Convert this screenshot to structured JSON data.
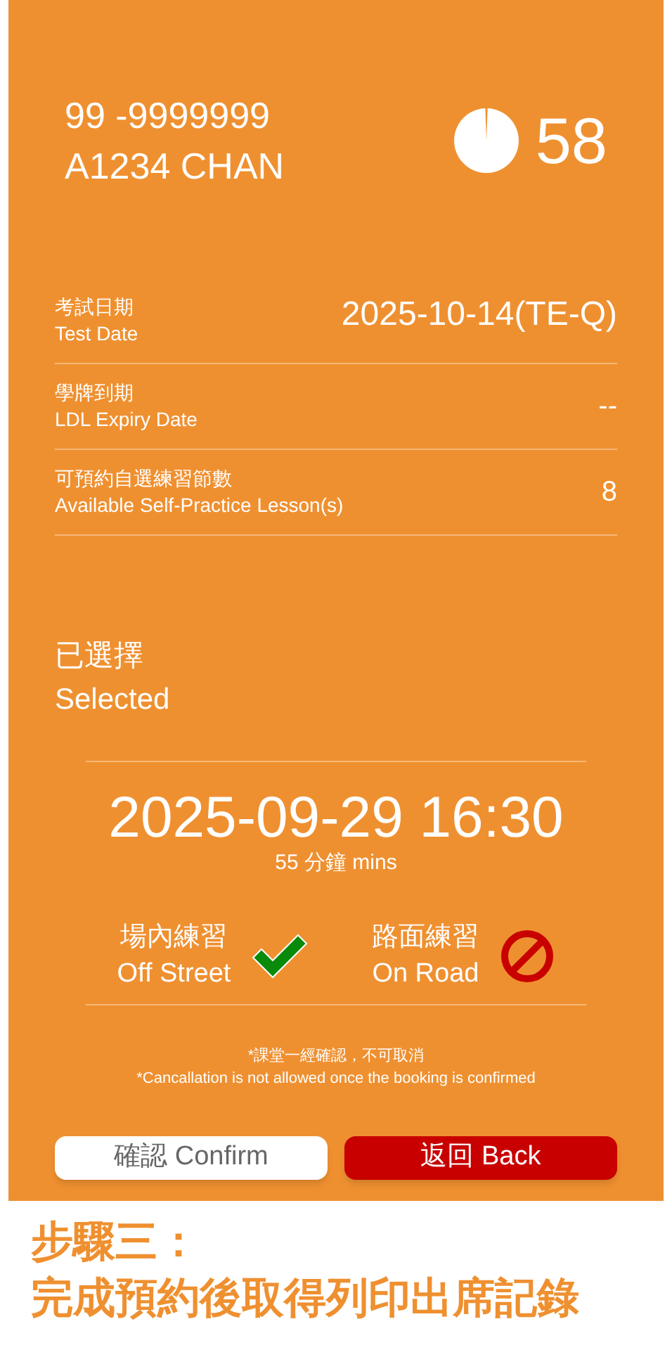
{
  "profile": {
    "phone": "99 -9999999",
    "name": "A1234 CHAN",
    "count": "58"
  },
  "info_rows": [
    {
      "label_zh": "考試日期",
      "label_en": "Test Date",
      "value": "2025-10-14(TE-Q)",
      "kind": "large"
    },
    {
      "label_zh": "學牌到期",
      "label_en": "LDL Expiry Date",
      "value": "--",
      "kind": "normal"
    },
    {
      "label_zh": "可預約自選練習節數",
      "label_en": "Available Self-Practice Lesson(s)",
      "value": "8",
      "kind": "normal"
    }
  ],
  "selected": {
    "heading_zh": "已選擇",
    "heading_en": "Selected",
    "datetime": "2025-09-29 16:30",
    "duration": "55 分鐘 mins"
  },
  "practice_types": [
    {
      "label_zh": "場內練習",
      "label_en": "Off Street",
      "available": true
    },
    {
      "label_zh": "路面練習",
      "label_en": "On Road",
      "available": false
    }
  ],
  "notice": {
    "zh": "*課堂一經確認，不可取消",
    "en": "*Cancallation is not allowed once the booking is confirmed"
  },
  "buttons": [
    {
      "label": "確認 Confirm",
      "kind": "secondary"
    },
    {
      "label": "返回 Back",
      "kind": "primary"
    }
  ],
  "caption": {
    "line1": "步驟三：",
    "line2": "完成預約後取得列印出席記錄"
  }
}
